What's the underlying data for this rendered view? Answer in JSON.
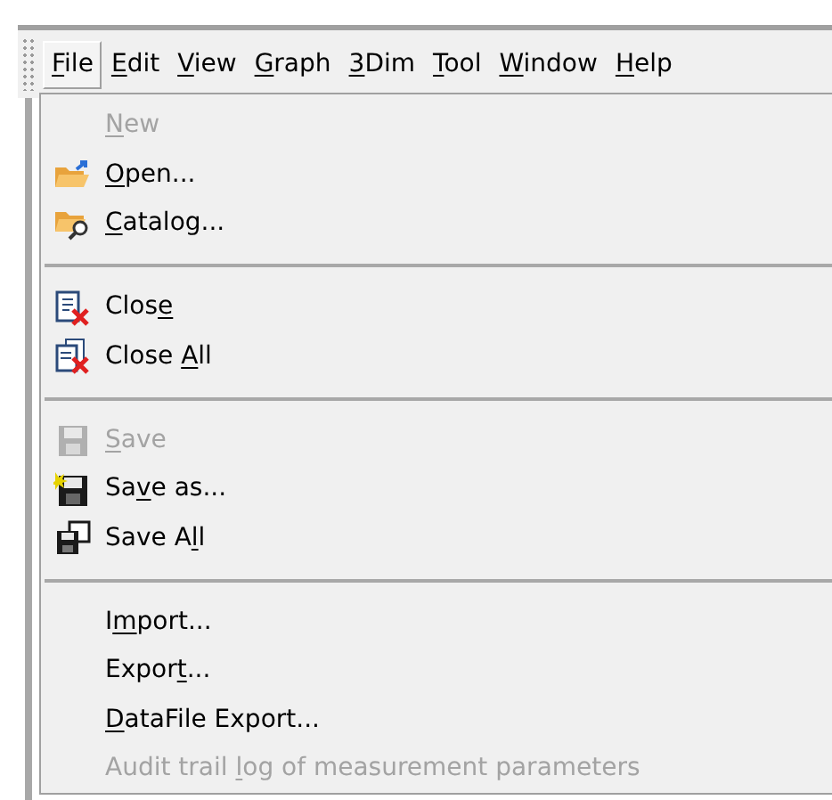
{
  "menubar": [
    {
      "label": {
        "key": "F",
        "post": "ile"
      },
      "selected": true
    },
    {
      "label": {
        "key": "E",
        "post": "dit"
      },
      "selected": false
    },
    {
      "label": {
        "key": "V",
        "post": "iew"
      },
      "selected": false
    },
    {
      "label": {
        "key": "G",
        "post": "raph"
      },
      "selected": false
    },
    {
      "label": {
        "key": "3",
        "post": "Dim"
      },
      "selected": false
    },
    {
      "label": {
        "key": "T",
        "post": "ool"
      },
      "selected": false
    },
    {
      "label": {
        "key": "W",
        "post": "indow"
      },
      "selected": false
    },
    {
      "label": {
        "key": "H",
        "post": "elp"
      },
      "selected": false
    }
  ],
  "file_menu": [
    {
      "kind": "item",
      "label": {
        "key": "N",
        "post": "ew"
      },
      "disabled": true
    },
    {
      "kind": "item",
      "label": {
        "key": "O",
        "post": "pen..."
      },
      "disabled": false
    },
    {
      "kind": "item",
      "label": {
        "key": "C",
        "post": "atalog..."
      },
      "disabled": false
    },
    {
      "kind": "separator"
    },
    {
      "kind": "item",
      "label": {
        "pre": "Clos",
        "key": "e"
      },
      "disabled": false
    },
    {
      "kind": "item",
      "label": {
        "pre": "Close ",
        "key": "A",
        "post": "ll"
      },
      "disabled": false
    },
    {
      "kind": "separator"
    },
    {
      "kind": "item",
      "label": {
        "key": "S",
        "post": "ave"
      },
      "disabled": true
    },
    {
      "kind": "item",
      "label": {
        "pre": "Sa",
        "key": "v",
        "post": "e as..."
      },
      "disabled": false
    },
    {
      "kind": "item",
      "label": {
        "pre": "Save A",
        "key": "l",
        "post": "l"
      },
      "disabled": false
    },
    {
      "kind": "separator"
    },
    {
      "kind": "item",
      "label": {
        "pre": "I",
        "key": "m",
        "post": "port..."
      },
      "disabled": false
    },
    {
      "kind": "item",
      "label": {
        "pre": "Expor",
        "key": "t",
        "post": "..."
      },
      "disabled": false
    },
    {
      "kind": "item",
      "label": {
        "key": "D",
        "post": "ataFile Export..."
      },
      "disabled": false
    },
    {
      "kind": "item",
      "label": {
        "pre": "Audit trail ",
        "key": "l",
        "post": "og of measurement parameters"
      },
      "disabled": true
    }
  ]
}
